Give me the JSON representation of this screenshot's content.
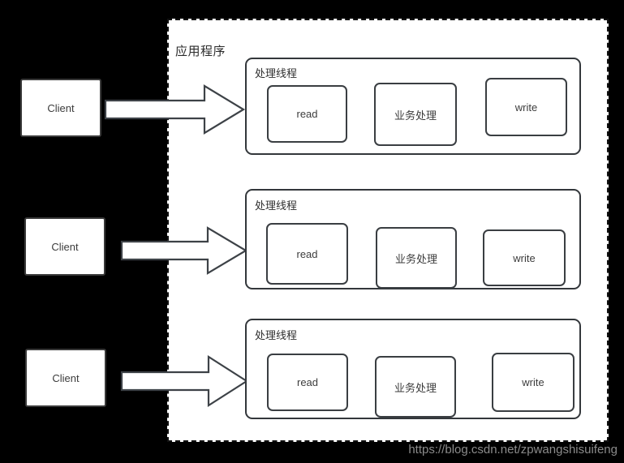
{
  "diagram": {
    "title": "应用程序",
    "background_color": "#000000",
    "panel_color": "#ffffff",
    "border_color": "#111111",
    "text_color": "#3c3c3c",
    "app_container_label": "应用程序",
    "clients": [
      {
        "label": "Client"
      },
      {
        "label": "Client"
      },
      {
        "label": "Client"
      }
    ],
    "threads": [
      {
        "label": "处理线程",
        "stages": [
          {
            "label": "read"
          },
          {
            "label": "业务处理"
          },
          {
            "label": "write"
          }
        ]
      },
      {
        "label": "处理线程",
        "stages": [
          {
            "label": "read"
          },
          {
            "label": "业务处理"
          },
          {
            "label": "write"
          }
        ]
      },
      {
        "label": "处理线程",
        "stages": [
          {
            "label": "read"
          },
          {
            "label": "业务处理"
          },
          {
            "label": "write"
          }
        ]
      }
    ],
    "arrows": [
      {
        "name": "client-to-thread-arrow-1"
      },
      {
        "name": "client-to-thread-arrow-2"
      },
      {
        "name": "client-to-thread-arrow-3"
      }
    ],
    "watermark": "https://blog.csdn.net/zpwangshisuifeng"
  }
}
